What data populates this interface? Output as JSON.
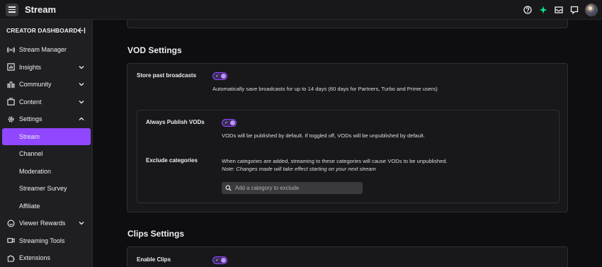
{
  "header": {
    "title": "Stream"
  },
  "topbar_icons": [
    "help-icon",
    "prime-loot-icon",
    "inbox-icon",
    "whispers-icon"
  ],
  "sidebar": {
    "heading": "CREATOR DASHBOARD",
    "items": [
      {
        "label": "Stream Manager",
        "icon": "broadcast-icon"
      },
      {
        "label": "Insights",
        "icon": "insights-icon",
        "chevron": "down"
      },
      {
        "label": "Community",
        "icon": "community-icon",
        "chevron": "down"
      },
      {
        "label": "Content",
        "icon": "content-icon",
        "chevron": "down"
      },
      {
        "label": "Settings",
        "icon": "gear-icon",
        "chevron": "up"
      }
    ],
    "settings_sub": [
      "Stream",
      "Channel",
      "Moderation",
      "Streamer Survey",
      "Affiliate"
    ],
    "items_after": [
      {
        "label": "Viewer Rewards",
        "icon": "rewards-icon",
        "chevron": "down"
      },
      {
        "label": "Streaming Tools",
        "icon": "camera-icon"
      },
      {
        "label": "Extensions",
        "icon": "puzzle-icon"
      }
    ]
  },
  "vod": {
    "title": "VOD Settings",
    "store_label": "Store past broadcasts",
    "store_desc": "Automatically save broadcasts for up to 14 days (60 days for Partners, Turbo and Prime users)",
    "store_on": true,
    "publish_label": "Always Publish VODs",
    "publish_desc": "VODs will be published by default. If toggled off, VODs will be unpublished by default.",
    "publish_on": true,
    "exclude_label": "Exclude categories",
    "exclude_desc": "When categories are added, streaming to these categories will cause VODs to be unpublished.",
    "exclude_note": "Note: Changes made will take effect starting on your next stream",
    "exclude_placeholder": "Add a category to exclude"
  },
  "clips": {
    "title": "Clips Settings",
    "enable_label": "Enable Clips",
    "enable_on": true
  },
  "colors": {
    "accent": "#9147ff",
    "sidebar_bg": "#1f1f23",
    "card_bg": "#18181b"
  }
}
